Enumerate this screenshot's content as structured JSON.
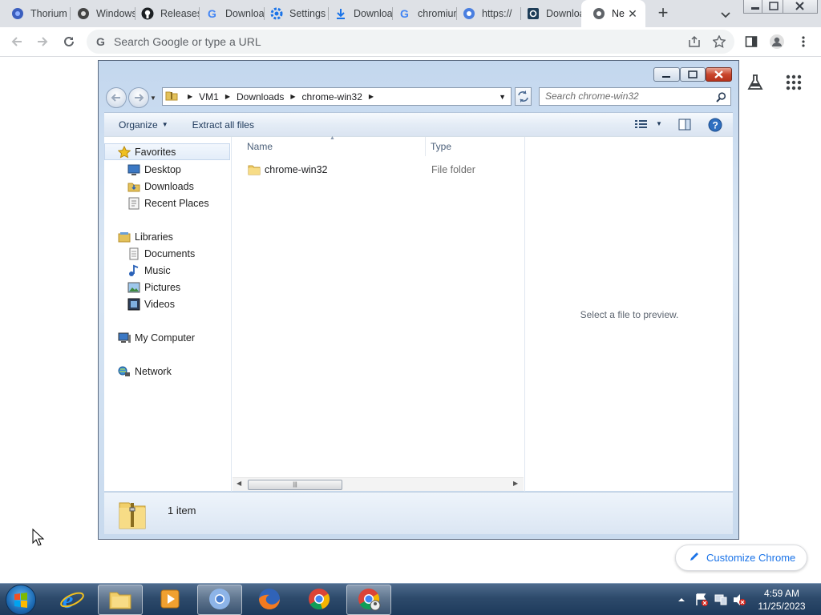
{
  "browser": {
    "tabs": [
      {
        "label": "Thorium",
        "icon": "thorium-icon"
      },
      {
        "label": "Windows",
        "icon": "windows-icon"
      },
      {
        "label": "Releases",
        "icon": "github-icon"
      },
      {
        "label": "Downloads",
        "icon": "google-icon"
      },
      {
        "label": "Settings",
        "icon": "settings-gear-icon"
      },
      {
        "label": "Downloads",
        "icon": "download-icon"
      },
      {
        "label": "chromium",
        "icon": "google-icon"
      },
      {
        "label": "https://",
        "icon": "web-icon"
      },
      {
        "label": "Downloads",
        "icon": "q-icon"
      },
      {
        "label": "New Tab",
        "icon": "chrome-icon"
      }
    ],
    "omnibox_placeholder": "Search Google or type a URL",
    "customize_label": "Customize Chrome"
  },
  "explorer": {
    "breadcrumb": [
      "VM1",
      "Downloads",
      "chrome-win32"
    ],
    "search_placeholder": "Search chrome-win32",
    "commands": {
      "organize": "Organize",
      "extract": "Extract all files"
    },
    "nav": {
      "favorites": "Favorites",
      "desktop": "Desktop",
      "downloads": "Downloads",
      "recent": "Recent Places",
      "libraries": "Libraries",
      "documents": "Documents",
      "music": "Music",
      "pictures": "Pictures",
      "videos": "Videos",
      "computer": "My Computer",
      "network": "Network"
    },
    "columns": {
      "name": "Name",
      "type": "Type"
    },
    "files": [
      {
        "name": "chrome-win32",
        "type": "File folder"
      }
    ],
    "preview_text": "Select a file to preview.",
    "item_count": "1 item",
    "scroll_thumb": "|||"
  },
  "taskbar": {
    "time": "4:59 AM",
    "date": "11/25/2023"
  }
}
